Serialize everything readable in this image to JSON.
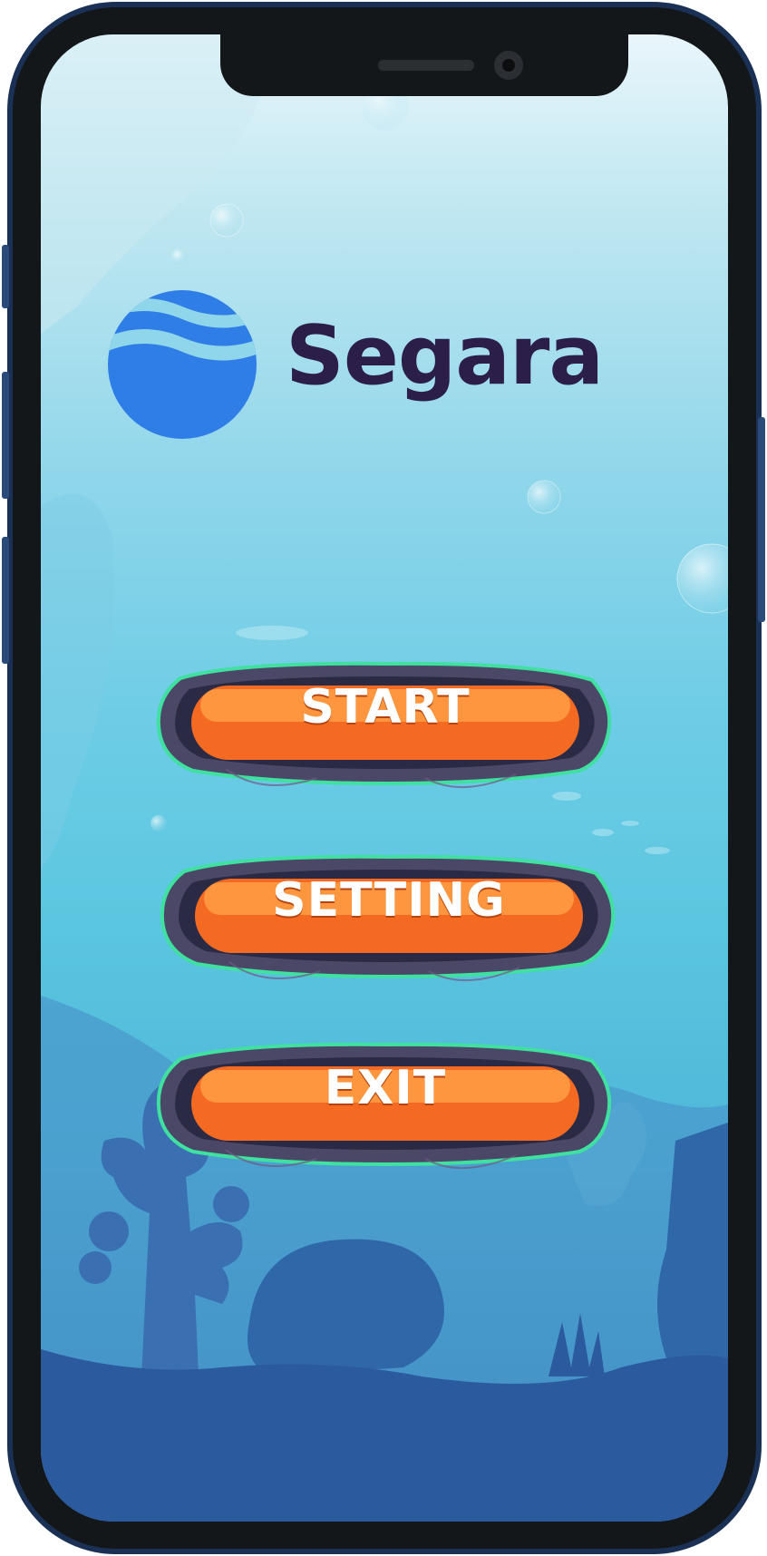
{
  "app": {
    "brand_name": "Segara",
    "logo_icon": "wave-globe-icon"
  },
  "menu": {
    "items": [
      {
        "label": "START"
      },
      {
        "label": "SETTING"
      },
      {
        "label": "EXIT"
      }
    ]
  },
  "colors": {
    "brand_text": "#2b1f4a",
    "logo_blue": "#2f7de6",
    "button_orange": "#f56a22",
    "button_frame": "#4a4866",
    "button_glow": "#3fe0a0"
  }
}
